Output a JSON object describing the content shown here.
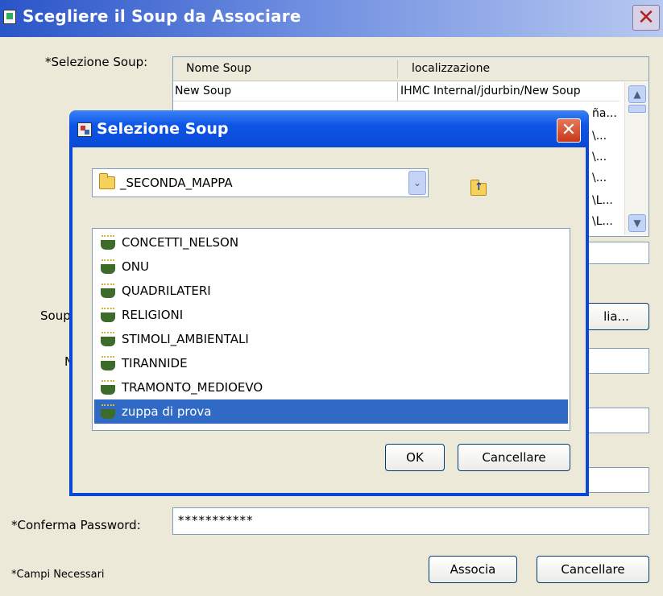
{
  "outer": {
    "title": "Scegliere il Soup da Associare",
    "close_glyph": "✕",
    "soup_selection_label": "*Selezione Soup:",
    "table": {
      "columns": [
        "Nome Soup",
        "localizzazione"
      ],
      "first_row": {
        "name": "New Soup",
        "location": "IHMC Internal/jdurbin/New Soup"
      },
      "partial_cells": [
        "ña...",
        "\\...",
        "\\...",
        "\\...",
        "\\L...",
        "\\L..."
      ]
    },
    "soup_label_fragment": "Soup",
    "side_label_fragment": "N",
    "browse_button_fragment": "lia...",
    "confirm_password_label": "*Conferma Password:",
    "confirm_password_value": "***********",
    "associate_button": "Associa",
    "cancel_button": "Cancellare",
    "required_note": "*Campi Necessari"
  },
  "dialog": {
    "title": "Selezione Soup",
    "close_glyph": "✕",
    "current_folder": "_SECONDA_MAPPA",
    "dropdown_glyph": "⌄",
    "items": [
      {
        "label": "CONCETTI_NELSON"
      },
      {
        "label": "ONU"
      },
      {
        "label": "QUADRILATERI"
      },
      {
        "label": "RELIGIONI"
      },
      {
        "label": "STIMOLI_AMBIENTALI"
      },
      {
        "label": "TIRANNIDE"
      },
      {
        "label": "TRAMONTO_MEDIOEVO"
      },
      {
        "label": "zuppa di prova"
      }
    ],
    "selected_item": "zuppa di prova",
    "ok_button": "OK",
    "cancel_button": "Cancellare"
  },
  "colors": {
    "xp_blue": "#0a47d8",
    "selection": "#316ac5",
    "window_bg": "#ece9d8"
  },
  "icons": [
    "app-icon",
    "close-icon",
    "folder-icon",
    "folder-up-icon",
    "soup-icon",
    "chevron-down-icon",
    "scroll-up-icon",
    "scroll-down-icon"
  ]
}
